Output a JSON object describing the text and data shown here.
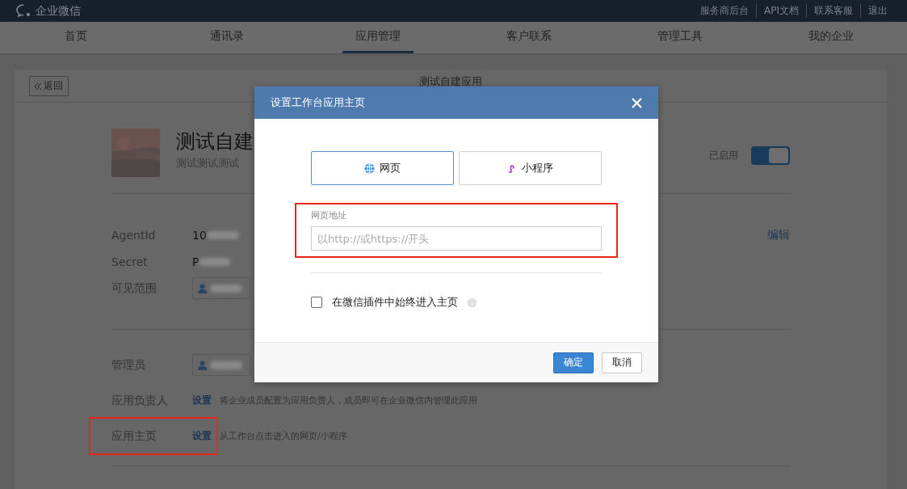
{
  "top_bar": {
    "brand": "企业微信",
    "links": [
      "服务商后台",
      "API文档",
      "联系客服",
      "退出"
    ]
  },
  "nav": [
    {
      "label": "首页",
      "selected": false
    },
    {
      "label": "通讯录",
      "selected": false
    },
    {
      "label": "应用管理",
      "selected": true
    },
    {
      "label": "客户联系",
      "selected": false
    },
    {
      "label": "管理工具",
      "selected": false
    },
    {
      "label": "我的企业",
      "selected": false
    }
  ],
  "page": {
    "back": "返回",
    "title": "测试自建应用",
    "app": {
      "name": "测试自建",
      "description": "测试测试测试",
      "status": "已启用",
      "enabled": true
    },
    "edit": "编辑",
    "fields": [
      {
        "kind": "text",
        "label": "AgentId",
        "value": "10"
      },
      {
        "kind": "text",
        "label": "Secret",
        "value": "P"
      },
      {
        "kind": "member",
        "label": "可见范围"
      }
    ],
    "roles": [
      {
        "kind": "member",
        "label": "管理员"
      },
      {
        "kind": "link",
        "label": "应用负责人",
        "action": "设置",
        "hint": "将企业成员配置为应用负责人，成员即可在企业微信内管理此应用",
        "highlighted": false
      },
      {
        "kind": "link",
        "label": "应用主页",
        "action": "设置",
        "hint": "从工作台点击进入的网页/小程序",
        "highlighted": true
      }
    ]
  },
  "dialog": {
    "title": "设置工作台应用主页",
    "tabs": [
      {
        "kind": "web",
        "label": "网页",
        "selected": true
      },
      {
        "kind": "mini",
        "label": "小程序",
        "selected": false
      }
    ],
    "field": {
      "label": "网页地址",
      "placeholder": "以http://或https://开头",
      "highlighted": true
    },
    "checkbox": {
      "label": "在微信插件中始终进入主页",
      "checked": false
    },
    "buttons": [
      {
        "label": "确定",
        "primary": true
      },
      {
        "label": "取消",
        "primary": false
      }
    ]
  }
}
